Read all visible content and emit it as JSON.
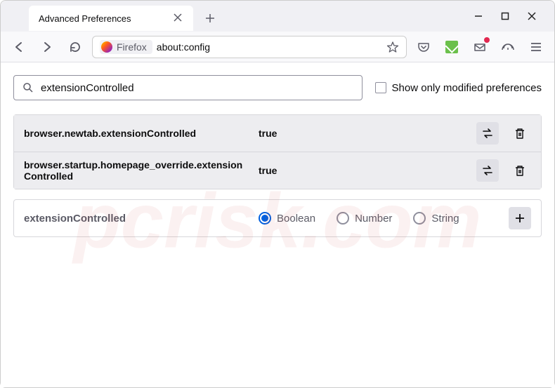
{
  "window": {
    "tab_title": "Advanced Preferences"
  },
  "urlbar": {
    "identity_label": "Firefox",
    "url": "about:config"
  },
  "search": {
    "value": "extensionControlled",
    "show_modified_label": "Show only modified preferences"
  },
  "prefs": [
    {
      "name": "browser.newtab.extensionControlled",
      "value": "true"
    },
    {
      "name": "browser.startup.homepage_override.extensionControlled",
      "value": "true"
    }
  ],
  "new_pref": {
    "name": "extensionControlled",
    "types": [
      "Boolean",
      "Number",
      "String"
    ],
    "selected": "Boolean"
  },
  "watermark": "pcrisk.com"
}
